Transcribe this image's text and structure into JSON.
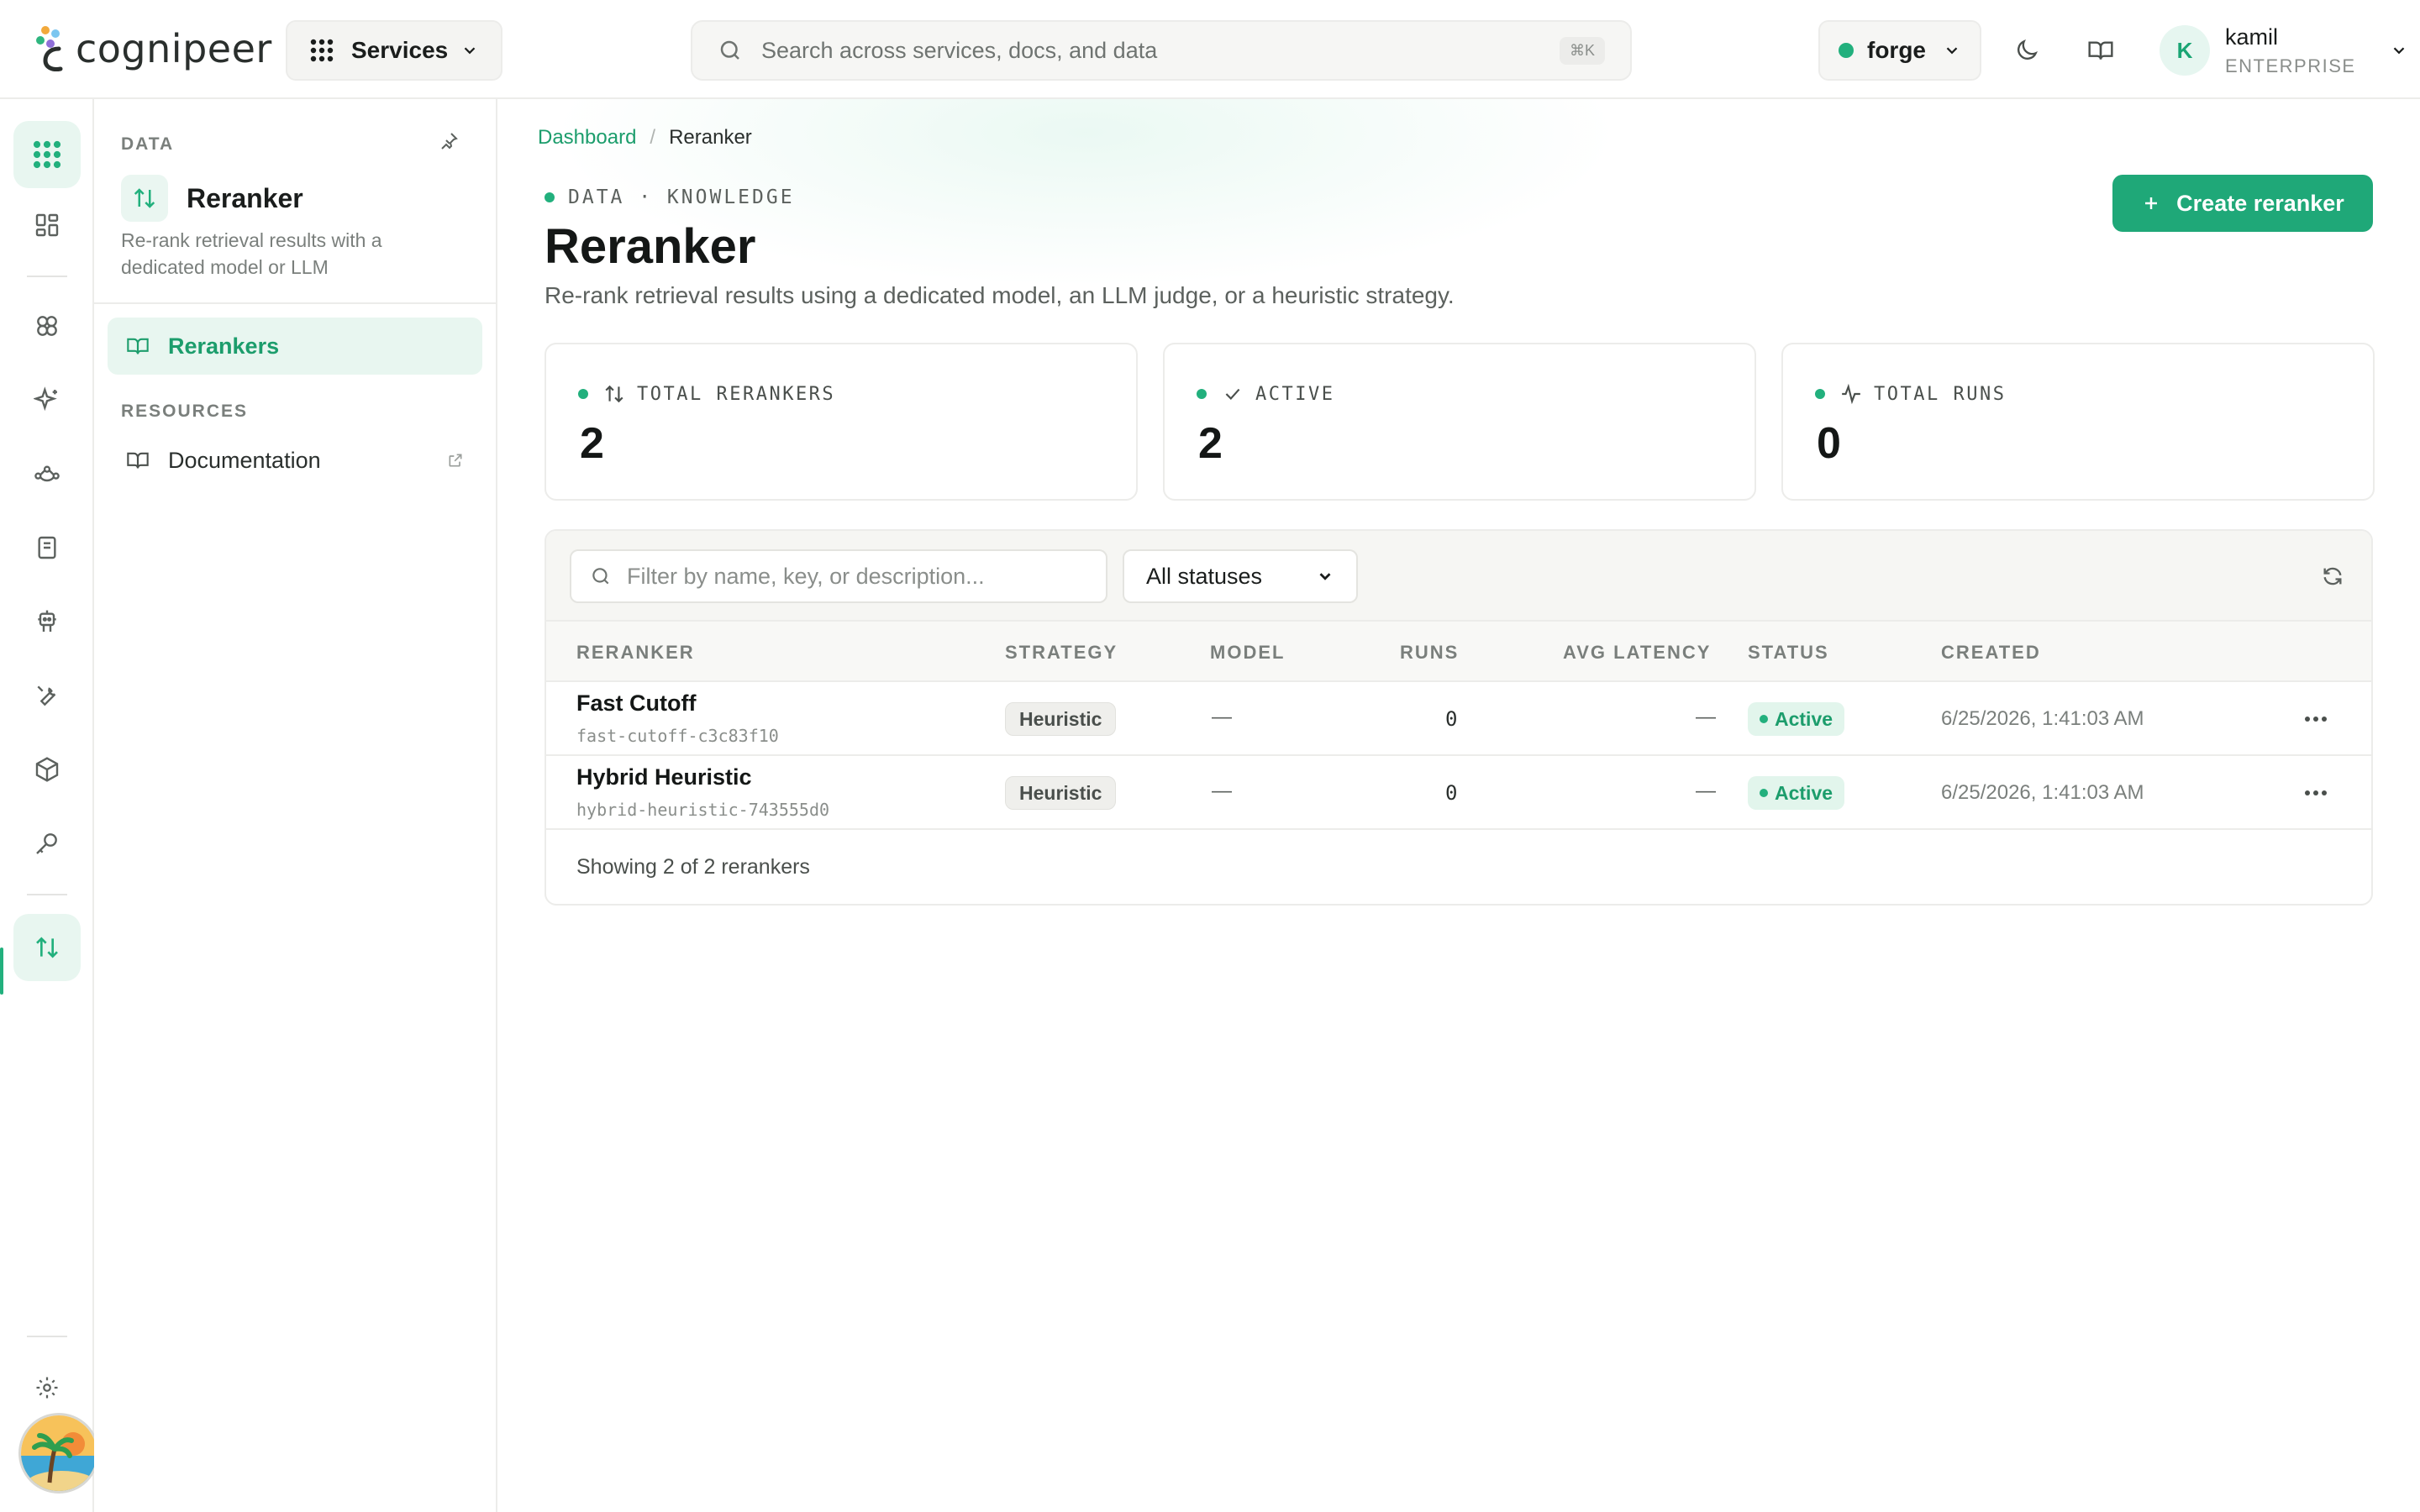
{
  "app": {
    "logo_text": "cognipeer"
  },
  "topbar": {
    "services_label": "Services",
    "search_placeholder": "Search across services, docs, and data",
    "search_shortcut": "⌘K",
    "workspace": "forge",
    "user": {
      "name": "kamil",
      "plan": "ENTERPRISE",
      "initial": "K"
    }
  },
  "sidebar": {
    "section": "DATA",
    "title": "Reranker",
    "description": "Re-rank retrieval results with a dedicated model or LLM",
    "items": [
      {
        "label": "Rerankers",
        "active": true
      }
    ],
    "resources_label": "RESOURCES",
    "resources": [
      {
        "label": "Documentation"
      }
    ]
  },
  "breadcrumb": {
    "root": "Dashboard",
    "separator": "/",
    "current": "Reranker"
  },
  "header": {
    "eyebrow": "DATA · KNOWLEDGE",
    "title": "Reranker",
    "subtitle": "Re-rank retrieval results using a dedicated model, an LLM judge, or a heuristic strategy.",
    "create_label": "Create reranker"
  },
  "stats": [
    {
      "label": "TOTAL RERANKERS",
      "value": "2"
    },
    {
      "label": "ACTIVE",
      "value": "2"
    },
    {
      "label": "TOTAL RUNS",
      "value": "0"
    }
  ],
  "table": {
    "filter_placeholder": "Filter by name, key, or description...",
    "status_filter": "All statuses",
    "columns": [
      "RERANKER",
      "STRATEGY",
      "MODEL",
      "RUNS",
      "AVG LATENCY",
      "STATUS",
      "CREATED"
    ],
    "rows": [
      {
        "name": "Fast Cutoff",
        "key": "fast-cutoff-c3c83f10",
        "strategy": "Heuristic",
        "model": "—",
        "runs": "0",
        "latency": "—",
        "status": "Active",
        "created": "6/25/2026, 1:41:03 AM"
      },
      {
        "name": "Hybrid Heuristic",
        "key": "hybrid-heuristic-743555d0",
        "strategy": "Heuristic",
        "model": "—",
        "runs": "0",
        "latency": "—",
        "status": "Active",
        "created": "6/25/2026, 1:41:03 AM"
      }
    ],
    "footer": "Showing 2 of 2 rerankers"
  },
  "colors": {
    "accent": "#1fa878",
    "accent_soft": "#e8f6f0",
    "border": "#ececea"
  },
  "icons": {
    "rail": [
      "apps-grid-icon",
      "dashboard-icon",
      "brain-icon",
      "sparkles-icon",
      "workflow-icon",
      "notebook-icon",
      "robot-icon",
      "tools-icon",
      "cube-icon",
      "key-icon",
      "rerank-arrows-icon",
      "settings-icon"
    ]
  }
}
